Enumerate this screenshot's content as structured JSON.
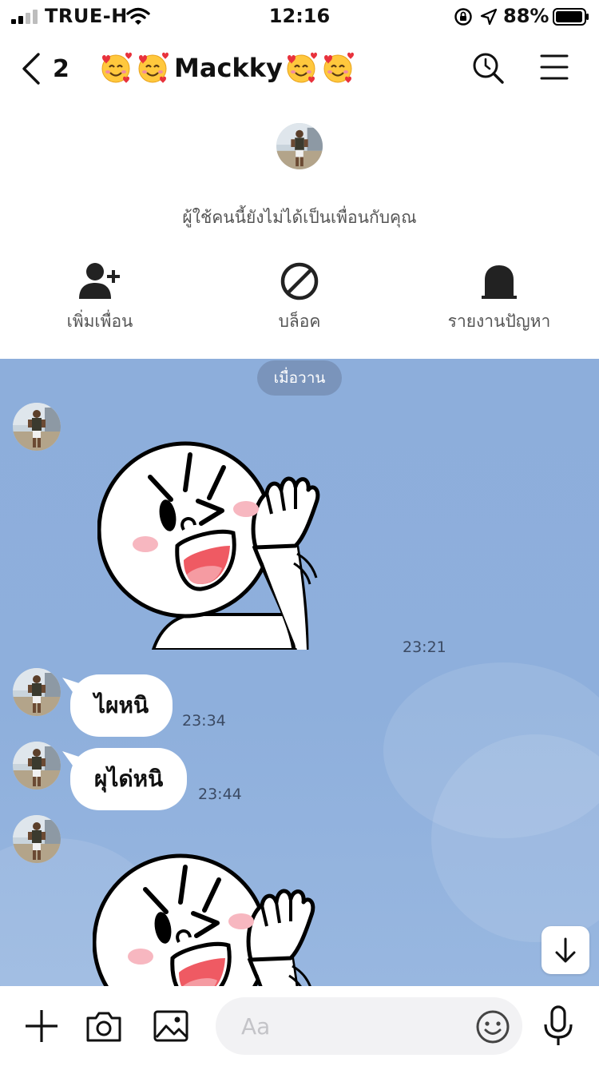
{
  "status_bar": {
    "carrier": "TRUE-H",
    "time": "12:16",
    "battery": "88%",
    "icons": [
      "signal-icon",
      "wifi-icon",
      "orientation-lock-icon",
      "location-icon",
      "battery-icon"
    ]
  },
  "header": {
    "back_count": "2",
    "title_name": "Mackky",
    "title_emoji": "smiling-face-with-hearts",
    "icons": [
      "back-chevron-icon",
      "search-history-icon",
      "menu-icon"
    ]
  },
  "profile": {
    "notice": "ผู้ใช้คนนี้ยังไม่ได้เป็นเพื่อนกับคุณ",
    "actions": [
      {
        "label": "เพิ่มเพื่อน",
        "icon": "add-friend-icon"
      },
      {
        "label": "บล็อค",
        "icon": "block-icon"
      },
      {
        "label": "รายงานปัญหา",
        "icon": "report-icon"
      }
    ]
  },
  "chat": {
    "date_divider": "เมื่อวาน",
    "messages": [
      {
        "type": "sticker",
        "sticker": "waving-character",
        "time": "23:21"
      },
      {
        "type": "text",
        "text": "ไผหนิ",
        "time": "23:34"
      },
      {
        "type": "text",
        "text": "ผุได่หนิ",
        "time": "23:44"
      },
      {
        "type": "sticker",
        "sticker": "waving-character",
        "time": ""
      }
    ],
    "scroll_icon": "arrow-down-icon"
  },
  "input_bar": {
    "placeholder": "Aa",
    "icons": [
      "plus-icon",
      "camera-icon",
      "image-icon",
      "emoji-icon",
      "microphone-icon"
    ]
  },
  "colors": {
    "chat_background": "#8eafdc",
    "date_pill": "#7a94bb",
    "bubble": "#ffffff",
    "blush": "#f7b7c0",
    "mouth": "#ef5a63"
  }
}
